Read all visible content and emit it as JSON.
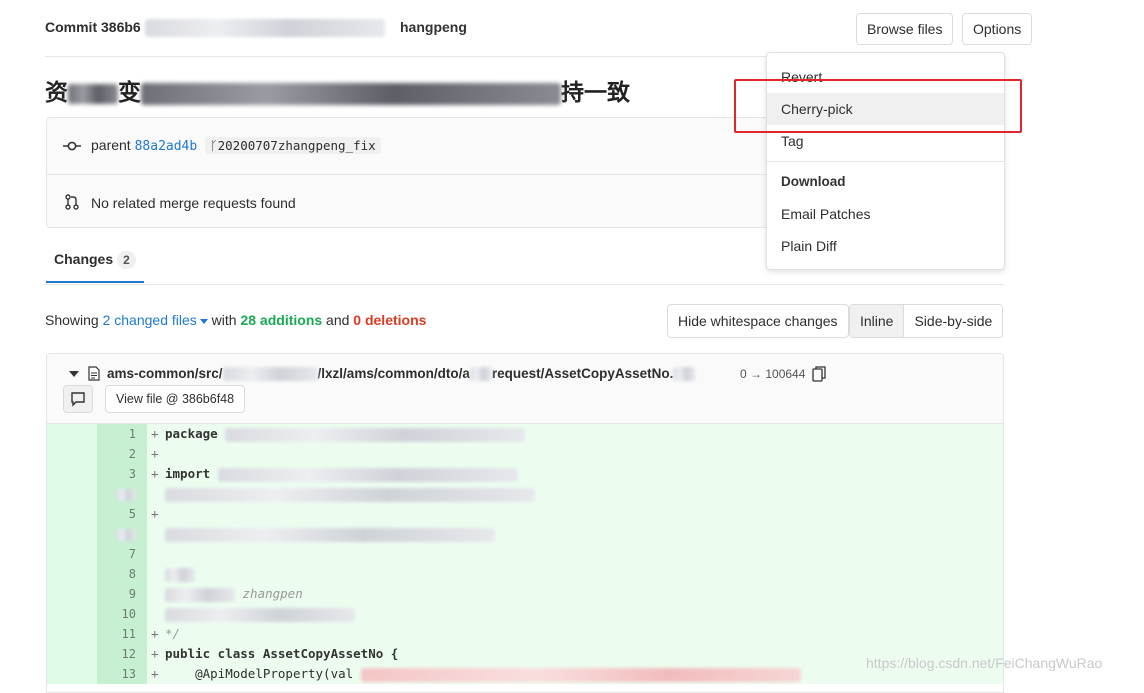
{
  "header": {
    "commit_label": "Commit",
    "commit_hash_prefix": "386b6",
    "author": "hangpeng",
    "browse_files_label": "Browse files",
    "options_label": "Options"
  },
  "title": {
    "start": "资",
    "mid": "变",
    "end": "持一致"
  },
  "info": {
    "parent_label": "parent",
    "parent_hash": "88a2ad4b",
    "branch": "20200707zhangpeng_fix",
    "no_mr_text": "No related merge requests found"
  },
  "tabs": [
    {
      "label": "Changes",
      "count": "2"
    }
  ],
  "summary": {
    "showing": "Showing",
    "changed_files": "2 changed files",
    "with": "with",
    "additions": "28 additions",
    "and": "and",
    "deletions": "0 deletions"
  },
  "toolbar": {
    "hide_whitespace_label": "Hide whitespace changes",
    "inline_label": "Inline",
    "side_by_side_label": "Side-by-side"
  },
  "file": {
    "path_start": "ams-common/src/",
    "path_mid": "/lxzl/ams/common/dto/a",
    "path_end": "request/AssetCopyAssetNo.",
    "mode": "0 → 100644",
    "view_file_label": "View file @ 386b6f48"
  },
  "code_lines": [
    {
      "num": "1",
      "text": "package"
    },
    {
      "num": "2",
      "text": ""
    },
    {
      "num": "3",
      "text": "import"
    },
    {
      "num": "",
      "text": ""
    },
    {
      "num": "5",
      "text": ""
    },
    {
      "num": "",
      "text": ""
    },
    {
      "num": "7",
      "text": ""
    },
    {
      "num": "8",
      "text": ""
    },
    {
      "num": "9",
      "text": "zhangpen"
    },
    {
      "num": "10",
      "text": ""
    },
    {
      "num": "11",
      "text": "*/"
    },
    {
      "num": "12",
      "text": "public class AssetCopyAssetNo {"
    },
    {
      "num": "13",
      "text": "@ApiModelProperty(val"
    }
  ],
  "dropdown": {
    "revert": "Revert",
    "cherry_pick": "Cherry-pick",
    "tag": "Tag",
    "download_header": "Download",
    "email_patches": "Email Patches",
    "plain_diff": "Plain Diff"
  },
  "watermark": "https://blog.csdn.net/FeiChangWuRao",
  "colors": {
    "link": "#1f78d1",
    "additions": "#1aaa55",
    "deletions": "#db3b21",
    "added_line_bg": "#ecfdf0",
    "highlight": "#e0262a"
  }
}
